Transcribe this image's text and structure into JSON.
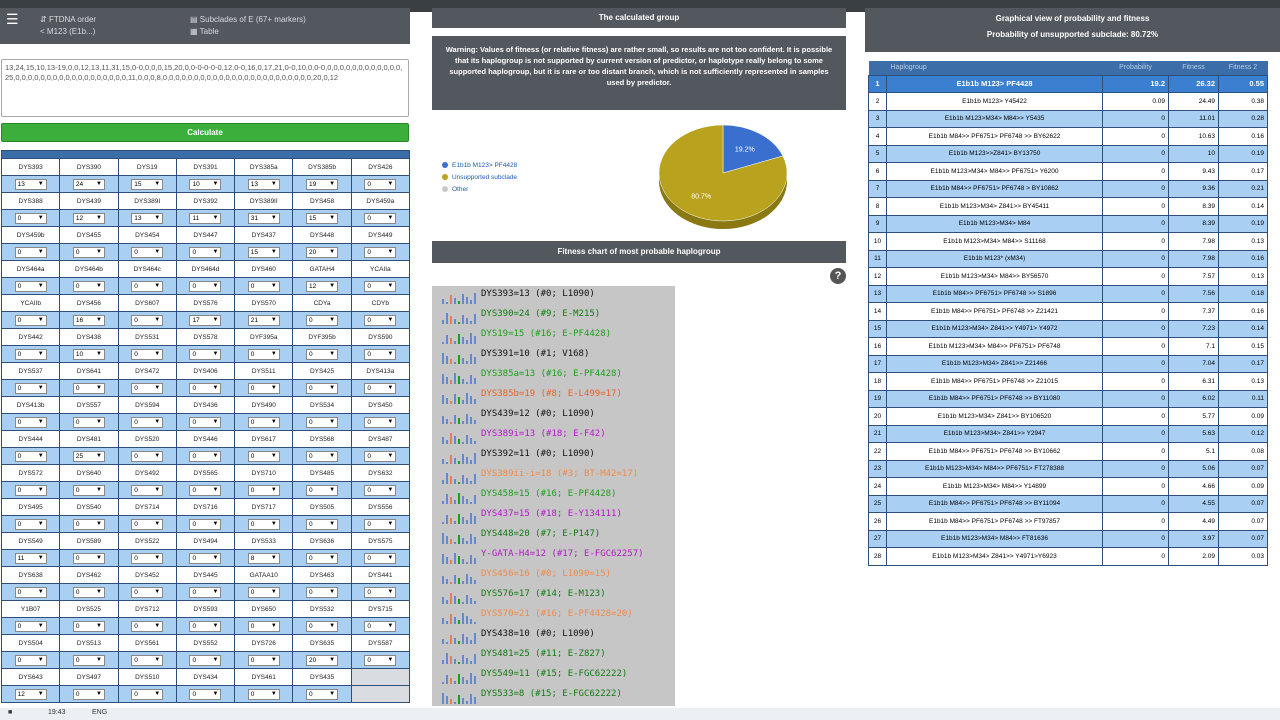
{
  "header": {
    "ftdna_order": "FTDNA order",
    "m123": "M123 (E1b...)",
    "subclades": "Subclades of E (67+ markers)",
    "table": "Table"
  },
  "textarea_value": "13,24,15,10,13-19,0,0,12,13,11,31,15,0-0,0,0,0,15,20,0,0-0-0-0-0,12,0-0,16,0,17,21,0-0,10,0,0-0,0,0,0,0,0,0,0,0,0,0,0,0,25,0,0,0,0,0,0,0,0,0,0,0,0,0,0,0,0,0,0,11,0,0,0,8,0,0,0,0,0,0,0,0,0,0,0,0,0,0,0,0,0,0,0,0,0,0,0,0,20,0,12",
  "calculate_label": "Calculate",
  "markers": [
    [
      [
        "DYS393",
        "13"
      ],
      [
        "DYS390",
        "24"
      ],
      [
        "DYS19",
        "15"
      ],
      [
        "DYS391",
        "10"
      ],
      [
        "DYS385a",
        "13"
      ],
      [
        "DYS385b",
        "19"
      ],
      [
        "DYS426",
        "0"
      ]
    ],
    [
      [
        "DYS388",
        "0"
      ],
      [
        "DYS439",
        "12"
      ],
      [
        "DYS389I",
        "13"
      ],
      [
        "DYS392",
        "11"
      ],
      [
        "DYS389II",
        "31"
      ],
      [
        "DYS458",
        "15"
      ],
      [
        "DYS459a",
        "0"
      ]
    ],
    [
      [
        "DYS459b",
        "0"
      ],
      [
        "DYS455",
        "0"
      ],
      [
        "DYS454",
        "0"
      ],
      [
        "DYS447",
        "0"
      ],
      [
        "DYS437",
        "15"
      ],
      [
        "DYS448",
        "20"
      ],
      [
        "DYS449",
        "0"
      ]
    ],
    [
      [
        "DYS464a",
        "0"
      ],
      [
        "DYS464b",
        "0"
      ],
      [
        "DYS464c",
        "0"
      ],
      [
        "DYS464d",
        "0"
      ],
      [
        "DYS460",
        "0"
      ],
      [
        "GATAH4",
        "12"
      ],
      [
        "YCAIIa",
        "0"
      ]
    ],
    [
      [
        "YCAIIb",
        "0"
      ],
      [
        "DYS456",
        "16"
      ],
      [
        "DYS607",
        "0"
      ],
      [
        "DYS576",
        "17"
      ],
      [
        "DYS570",
        "21"
      ],
      [
        "CDYa",
        "0"
      ],
      [
        "CDYb",
        "0"
      ]
    ],
    [
      [
        "DYS442",
        "0"
      ],
      [
        "DYS438",
        "10"
      ],
      [
        "DYS531",
        "0"
      ],
      [
        "DYS578",
        "0"
      ],
      [
        "DYF395a",
        "0"
      ],
      [
        "DYF395b",
        "0"
      ],
      [
        "DYS590",
        "0"
      ]
    ],
    [
      [
        "DYS537",
        "0"
      ],
      [
        "DYS641",
        "0"
      ],
      [
        "DYS472",
        "0"
      ],
      [
        "DYS406",
        "0"
      ],
      [
        "DYS511",
        "0"
      ],
      [
        "DYS425",
        "0"
      ],
      [
        "DYS413a",
        "0"
      ]
    ],
    [
      [
        "DYS413b",
        "0"
      ],
      [
        "DYS557",
        "0"
      ],
      [
        "DYS594",
        "0"
      ],
      [
        "DYS436",
        "0"
      ],
      [
        "DYS490",
        "0"
      ],
      [
        "DYS534",
        "0"
      ],
      [
        "DYS450",
        "0"
      ]
    ],
    [
      [
        "DYS444",
        "0"
      ],
      [
        "DYS481",
        "25"
      ],
      [
        "DYS520",
        "0"
      ],
      [
        "DYS446",
        "0"
      ],
      [
        "DYS617",
        "0"
      ],
      [
        "DYS568",
        "0"
      ],
      [
        "DYS487",
        "0"
      ]
    ],
    [
      [
        "DYS572",
        "0"
      ],
      [
        "DYS640",
        "0"
      ],
      [
        "DYS492",
        "0"
      ],
      [
        "DYS565",
        "0"
      ],
      [
        "DYS710",
        "0"
      ],
      [
        "DYS485",
        "0"
      ],
      [
        "DYS632",
        "0"
      ]
    ],
    [
      [
        "DYS495",
        "0"
      ],
      [
        "DYS540",
        "0"
      ],
      [
        "DYS714",
        "0"
      ],
      [
        "DYS716",
        "0"
      ],
      [
        "DYS717",
        "0"
      ],
      [
        "DYS505",
        "0"
      ],
      [
        "DYS556",
        "0"
      ]
    ],
    [
      [
        "DYS549",
        "11"
      ],
      [
        "DYS589",
        "0"
      ],
      [
        "DYS522",
        "0"
      ],
      [
        "DYS494",
        "0"
      ],
      [
        "DYS533",
        "8"
      ],
      [
        "DYS636",
        "0"
      ],
      [
        "DYS575",
        "0"
      ]
    ],
    [
      [
        "DYS638",
        "0"
      ],
      [
        "DYS462",
        "0"
      ],
      [
        "DYS452",
        "0"
      ],
      [
        "DYS445",
        "0"
      ],
      [
        "GATAA10",
        "0"
      ],
      [
        "DYS463",
        "0"
      ],
      [
        "DYS441",
        "0"
      ]
    ],
    [
      [
        "Y1B07",
        "0"
      ],
      [
        "DYS525",
        "0"
      ],
      [
        "DYS712",
        "0"
      ],
      [
        "DYS593",
        "0"
      ],
      [
        "DYS650",
        "0"
      ],
      [
        "DYS532",
        "0"
      ],
      [
        "DYS715",
        "0"
      ]
    ],
    [
      [
        "DYS504",
        "0"
      ],
      [
        "DYS513",
        "0"
      ],
      [
        "DYS561",
        "0"
      ],
      [
        "DYS552",
        "0"
      ],
      [
        "DYS726",
        "0"
      ],
      [
        "DYS635",
        "20"
      ],
      [
        "DYS587",
        "0"
      ]
    ],
    [
      [
        "DYS643",
        "12"
      ],
      [
        "DYS497",
        "0"
      ],
      [
        "DYS510",
        "0"
      ],
      [
        "DYS434",
        "0"
      ],
      [
        "DYS461",
        "0"
      ],
      [
        "DYS435",
        "0"
      ],
      null
    ]
  ],
  "calculated_group_title": "The calculated group",
  "warning_text": "Warning: Values of fitness (or relative fitness) are rather small, so results are not too confident. It is possible that its haplogroup is not supported by current version of predictor, or haplotype really belong to some supported haplogroup, but it is rare or too distant branch, which is not sufficiently represented in samples used by predictor.",
  "pie": {
    "legend": [
      {
        "label": "E1b1b M123> PF4428",
        "color": "#3a6fd0"
      },
      {
        "label": "Unsupported subclade",
        "color": "#b8a21e"
      },
      {
        "label": "Other",
        "color": "#c8c8c8"
      }
    ],
    "slices": [
      {
        "value": 19.2,
        "label": "19.2%",
        "color": "#3a6fd0"
      },
      {
        "value": 80.7,
        "label": "80.7%",
        "color": "#b8a21e"
      }
    ]
  },
  "fitness_chart_title": "Fitness chart of most probable haplogroup",
  "help_symbol": "?",
  "fitness_rows": [
    {
      "text": "DYS393=13 (#0; L1090)",
      "color": "#111111"
    },
    {
      "text": "DYS390=24 (#9; E-M215)",
      "color": "#117a11"
    },
    {
      "text": "DYS19=15 (#16; E-PF4428)",
      "color": "#1aa01a"
    },
    {
      "text": "DYS391=10 (#1; V168)",
      "color": "#111111"
    },
    {
      "text": "DYS385a=13 (#16; E-PF4428)",
      "color": "#1aa01a"
    },
    {
      "text": "DYS385b=19 (#8; E-L499=17)",
      "color": "#e8622c"
    },
    {
      "text": "DYS439=12 (#0; L1090)",
      "color": "#111111"
    },
    {
      "text": "DYS389i=13 (#18; E-F42)",
      "color": "#b418c8"
    },
    {
      "text": "DYS392=11 (#0; L1090)",
      "color": "#111111"
    },
    {
      "text": "DYS389ii-i=18 (#3; BT-M42=17)",
      "color": "#f08a4a"
    },
    {
      "text": "DYS458=15 (#16; E-PF4428)",
      "color": "#1aa01a"
    },
    {
      "text": "DYS437=15 (#18; E-Y134111)",
      "color": "#b418c8"
    },
    {
      "text": "DYS448=20 (#7; E-P147)",
      "color": "#117a11"
    },
    {
      "text": "Y-GATA-H4=12 (#17; E-FGC62257)",
      "color": "#b418c8"
    },
    {
      "text": "DYS456=16 (#0; L1090=15)",
      "color": "#f08a4a"
    },
    {
      "text": "DYS576=17 (#14; E-M123)",
      "color": "#117a11"
    },
    {
      "text": "DYS570=21 (#16; E-PF4428=20)",
      "color": "#f08a4a"
    },
    {
      "text": "DYS438=10 (#0; L1090)",
      "color": "#111111"
    },
    {
      "text": "DYS481=25 (#11; E-Z827)",
      "color": "#117a11"
    },
    {
      "text": "DYS549=11 (#15; E-FGC62222)",
      "color": "#117a11"
    },
    {
      "text": "DYS533=8 (#15; E-FGC62222)",
      "color": "#117a11"
    }
  ],
  "graph_header_line1": "Graphical view of probability and fitness",
  "graph_header_line2": "Probability of unsupported subclade: 80.72%",
  "result_headers": [
    "Haplogroup",
    "Probability",
    "Fitness",
    "Fitness 2"
  ],
  "results": [
    [
      "1",
      "E1b1b M123> PF4428",
      "19.2",
      "26.32",
      "0.55"
    ],
    [
      "2",
      "E1b1b M123> Y45422",
      "0.09",
      "24.49",
      "0.38"
    ],
    [
      "3",
      "E1b1b M123>M34> M84>> Y5435",
      "0",
      "11.01",
      "0.28"
    ],
    [
      "4",
      "E1b1b M84>> PF6751> PF6748 >> BY62622",
      "0",
      "10.63",
      "0.16"
    ],
    [
      "5",
      "E1b1b M123>>Z841> BY13750",
      "0",
      "10",
      "0.19"
    ],
    [
      "6",
      "E1b1b M123>M34> M84>> PF6751> Y6200",
      "0",
      "9.43",
      "0.17"
    ],
    [
      "7",
      "E1b1b M84>> PF6751> PF6748 > BY10862",
      "0",
      "9.36",
      "0.21"
    ],
    [
      "8",
      "E1b1b M123>M34> Z841>> BY45411",
      "0",
      "8.39",
      "0.14"
    ],
    [
      "9",
      "E1b1b M123>M34> M84",
      "0",
      "8.39",
      "0.19"
    ],
    [
      "10",
      "E1b1b M123>M34> M84>> S11168",
      "0",
      "7.98",
      "0.13"
    ],
    [
      "11",
      "E1b1b M123* (xM34)",
      "0",
      "7.98",
      "0.16"
    ],
    [
      "12",
      "E1b1b M123>M34> M84>> BY56570",
      "0",
      "7.57",
      "0.13"
    ],
    [
      "13",
      "E1b1b M84>> PF6751> PF6748 >> S1896",
      "0",
      "7.56",
      "0.18"
    ],
    [
      "14",
      "E1b1b M84>> PF6751> PF6748 >> Z21421",
      "0",
      "7.37",
      "0.16"
    ],
    [
      "15",
      "E1b1b M123>M34> Z841>> Y4971> Y4972",
      "0",
      "7.23",
      "0.14"
    ],
    [
      "16",
      "E1b1b M123>M34> M84>> PF6751> PF6748",
      "0",
      "7.1",
      "0.15"
    ],
    [
      "17",
      "E1b1b M123>M34> Z841>> Z21466",
      "0",
      "7.04",
      "0.17"
    ],
    [
      "18",
      "E1b1b M84>> PF6751> PF6748 >> Z21015",
      "0",
      "6.31",
      "0.13"
    ],
    [
      "19",
      "E1b1b M84>> PF6751> PF6748 >> BY11080",
      "0",
      "6.02",
      "0.11"
    ],
    [
      "20",
      "E1b1b M123>M34> Z841>> BY106520",
      "0",
      "5.77",
      "0.09"
    ],
    [
      "21",
      "E1b1b M123>M34> Z841>> Y2947",
      "0",
      "5.63",
      "0.12"
    ],
    [
      "22",
      "E1b1b M84>> PF6751> PF6748 >> BY10662",
      "0",
      "5.1",
      "0.08"
    ],
    [
      "23",
      "E1b1b M123>M34> M84>> PF6751> FT278388",
      "0",
      "5.06",
      "0.07"
    ],
    [
      "24",
      "E1b1b M123>M34> M84>> Y14899",
      "0",
      "4.66",
      "0.09"
    ],
    [
      "25",
      "E1b1b M84>> PF6751> PF6748 >> BY11094",
      "0",
      "4.55",
      "0.07"
    ],
    [
      "26",
      "E1b1b M84>> PF6751> PF6748 >> FT97857",
      "0",
      "4.49",
      "0.07"
    ],
    [
      "27",
      "E1b1b M123>M34> M84>> FT81636",
      "0",
      "3.97",
      "0.07"
    ],
    [
      "28",
      "E1b1b M123>M34> Z841>> Y4971>Y6923",
      "0",
      "2.09",
      "0.03"
    ]
  ],
  "taskbar": {
    "time": "19:43",
    "lang": "ENG"
  }
}
